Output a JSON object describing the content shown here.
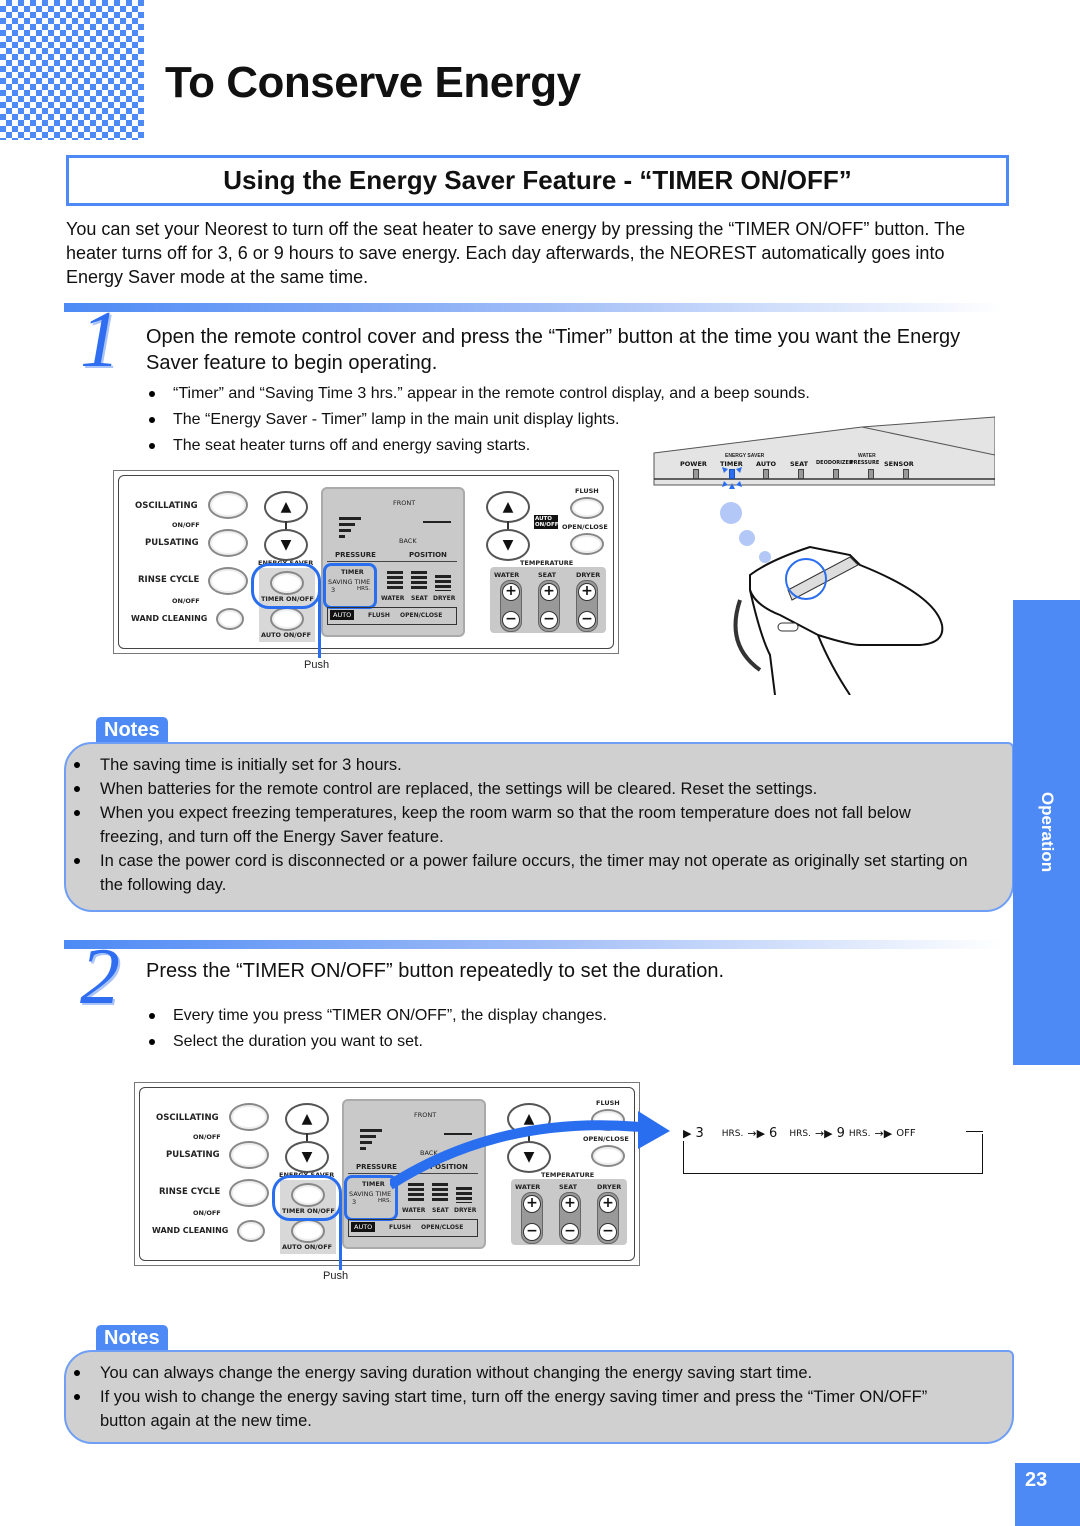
{
  "page": {
    "title": "To Conserve Energy",
    "section_heading": "Using the Energy Saver Feature - “TIMER ON/OFF”",
    "intro": "You can set your Neorest to turn off the seat heater to save energy by pressing the “TIMER ON/OFF” button. The heater turns off for 3, 6 or 9 hours to save energy. Each day afterwards, the NEOREST automatically goes into Energy Saver mode at the same time.",
    "side_tab": "Operation",
    "page_number": "23"
  },
  "step1": {
    "number": "1",
    "instruction": "Open the remote control cover and press the “Timer” button at the time you want the Energy Saver feature to begin operating.",
    "bullets": [
      "“Timer” and “Saving Time 3 hrs.” appear in the remote control display, and a beep sounds.",
      "The “Energy Saver - Timer” lamp in the main unit display lights.",
      "The seat heater turns off and energy saving starts."
    ],
    "push_caption": "Push"
  },
  "step2": {
    "number": "2",
    "instruction": "Press the “TIMER ON/OFF” button repeatedly to set the duration.",
    "bullets": [
      "Every time you press “TIMER ON/OFF”, the display changes.",
      "Select the duration you want to set."
    ],
    "push_caption": "Push",
    "sequence": [
      {
        "value": "3",
        "unit": "HRS."
      },
      {
        "value": "6",
        "unit": "HRS."
      },
      {
        "value": "9",
        "unit": "HRS."
      },
      {
        "value": "OFF",
        "unit": ""
      }
    ]
  },
  "notes1": {
    "label": "Notes",
    "items": [
      "The saving time is initially set for 3 hours.",
      "When batteries for the remote control are replaced, the settings will be cleared. Reset the settings.",
      "When you expect freezing temperatures, keep the room warm so that the room temperature does not fall below freezing, and turn off the Energy Saver feature.",
      "In case the power cord is disconnected or a power failure occurs, the timer may not operate as originally set starting on the following day."
    ]
  },
  "notes2": {
    "label": "Notes",
    "items": [
      "You can always change the energy saving duration without changing the energy saving start time.",
      "If you wish to change the energy saving start time, turn off the energy saving timer and press the “Timer ON/OFF” button again at the new time."
    ]
  },
  "remote": {
    "oscillating": "OSCILLATING",
    "onoff": "ON/OFF",
    "pulsating": "PULSATING",
    "rinse_cycle": "RINSE CYCLE",
    "wand_cleaning": "WAND CLEANING",
    "energy_saver": "ENERGY SAVER",
    "timer_onoff": "TIMER ON/OFF",
    "auto_onoff": "AUTO ON/OFF",
    "front": "FRONT",
    "back": "BACK",
    "pressure": "PRESSURE",
    "position": "POSITION",
    "timer": "TIMER",
    "saving_time": "SAVING TIME",
    "saving_value": "3",
    "hrs": "HRS.",
    "water": "WATER",
    "seat": "SEAT",
    "dryer": "DRYER",
    "auto": "AUTO",
    "flush": "FLUSH",
    "open_close": "OPEN/CLOSE",
    "auto_onoff_badge": "AUTO ON/OFF",
    "temperature": "TEMPERATURE",
    "up_arrow": "▲",
    "down_arrow": "▼",
    "plus": "+",
    "minus": "−"
  },
  "unit_display": {
    "energy_saver": "ENERGY SAVER",
    "water": "WATER",
    "lamps": [
      "POWER",
      "TIMER",
      "AUTO",
      "SEAT",
      "DEODORIZER",
      "PRESSURE",
      "SENSOR"
    ],
    "active_lamp": "TIMER",
    "accent": "#2a6ef0"
  },
  "colors": {
    "accent": "#4d8af5",
    "notes_bg": "#d0d0d0"
  }
}
